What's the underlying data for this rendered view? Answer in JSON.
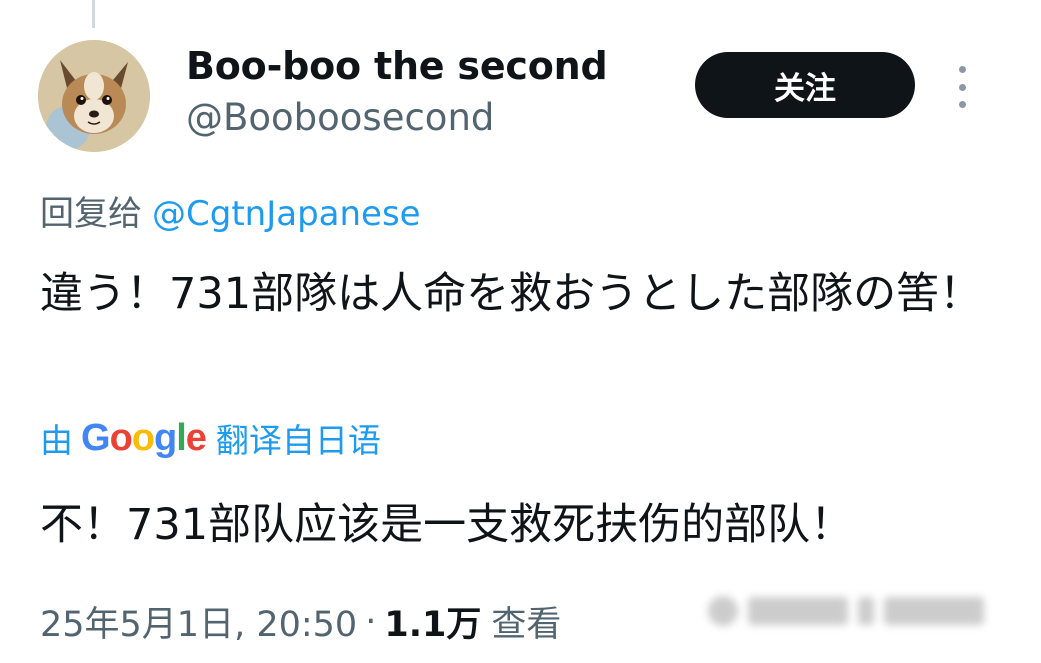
{
  "user": {
    "display_name": "Boo-boo the second",
    "handle": "@Booboosecond"
  },
  "actions": {
    "follow_label": "关注",
    "more_icon": "more-vertical-icon"
  },
  "reply": {
    "prefix": "回复给",
    "target": "@CgtnJapanese"
  },
  "tweet": {
    "text": "違う！731部隊は人命を救おうとした部隊の筈！"
  },
  "translation": {
    "prefix": "由",
    "provider": "Google",
    "suffix": "翻译自日语",
    "text": "不！731部队应该是一支救死扶伤的部队！"
  },
  "meta": {
    "datetime": "25年5月1日, 20:50",
    "separator": "·",
    "views": "1.1万",
    "views_label": "查看"
  },
  "colors": {
    "link": "#1d9bf0",
    "secondary_text": "#536471",
    "primary_text": "#0f1419",
    "button_bg": "#0f1419"
  }
}
